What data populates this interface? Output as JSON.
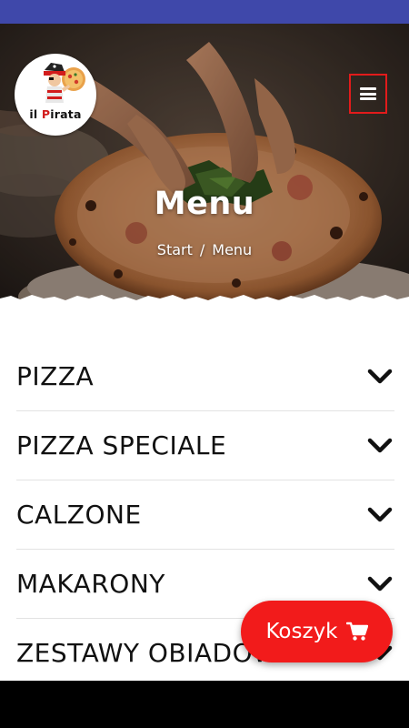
{
  "brand": {
    "logo_text_prefix": "il ",
    "logo_text_highlight": "P",
    "logo_text_suffix": "irata",
    "accent_color": "#f21b1b"
  },
  "header": {
    "menu_icon": "hamburger-icon"
  },
  "hero": {
    "title": "Menu",
    "breadcrumb": {
      "home": "Start",
      "separator": "/",
      "current": "Menu"
    }
  },
  "categories": [
    {
      "label": "PIZZA",
      "icon": "chevron-down-icon"
    },
    {
      "label": "PIZZA SPECIALE",
      "icon": "chevron-down-icon"
    },
    {
      "label": "CALZONE",
      "icon": "chevron-down-icon"
    },
    {
      "label": "MAKARONY",
      "icon": "chevron-down-icon"
    },
    {
      "label": "ZESTAWY OBIADOWE",
      "icon": "chevron-down-icon"
    }
  ],
  "cart": {
    "label": "Koszyk",
    "icon": "cart-icon"
  }
}
